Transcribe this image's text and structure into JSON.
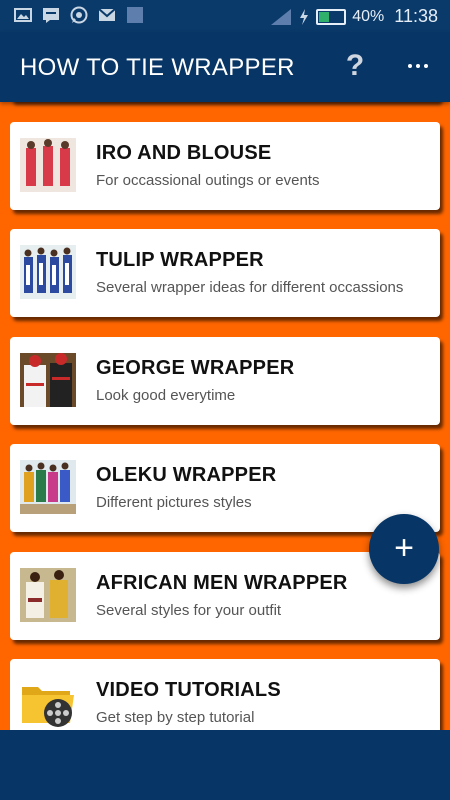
{
  "status": {
    "battery_percent": "40%",
    "battery_level": 0.4,
    "time": "11:38",
    "icons": [
      "image-icon",
      "chat-icon",
      "whatsapp-icon",
      "mail-icon",
      "square-icon",
      "signal-icon",
      "charging-icon",
      "battery-icon"
    ]
  },
  "app_bar": {
    "title": "HOW TO TIE WRAPPER",
    "help_label": "?",
    "more_icon": "more-vertical-icon"
  },
  "items": [
    {
      "title": "IRO AND BLOUSE",
      "subtitle": "For occassional outings or events",
      "thumb": "iro-and-blouse-thumbnail"
    },
    {
      "title": "TULIP WRAPPER",
      "subtitle": "Several wrapper ideas for different occassions",
      "thumb": "tulip-wrapper-thumbnail"
    },
    {
      "title": "GEORGE WRAPPER",
      "subtitle": "Look good everytime",
      "thumb": "george-wrapper-thumbnail"
    },
    {
      "title": "OLEKU WRAPPER",
      "subtitle": "Different pictures styles",
      "thumb": "oleku-wrapper-thumbnail"
    },
    {
      "title": "AFRICAN MEN WRAPPER",
      "subtitle": "Several styles for your outfit",
      "thumb": "african-men-wrapper-thumbnail"
    },
    {
      "title": "VIDEO TUTORIALS",
      "subtitle": "Get step by step tutorial",
      "thumb": "video-folder-icon"
    }
  ],
  "fab": {
    "label": "+",
    "icon": "plus-icon"
  },
  "colors": {
    "primary": "#063566",
    "background": "#ff6600",
    "card": "#ffffff"
  }
}
